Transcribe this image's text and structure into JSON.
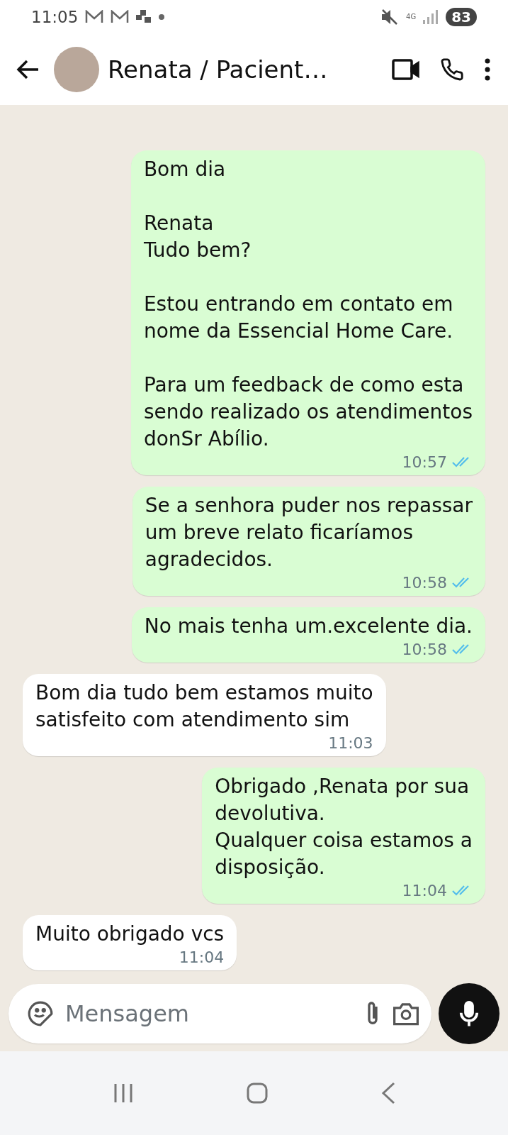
{
  "status_bar": {
    "time": "11:05",
    "network": "4G",
    "battery": "83"
  },
  "header": {
    "title": "Renata / Pacient…"
  },
  "messages": [
    {
      "kind": "sent",
      "text": "Bom dia\n\nRenata\nTudo bem?\n\nEstou entrando em contato em\nnome da Essencial Home Care.\n\nPara um feedback de como esta\nsendo realizado os atendimentos\ndonSr Abílio.",
      "time": "10:57",
      "read": true
    },
    {
      "kind": "sent",
      "text": "Se a senhora puder nos repassar\num breve relato ficaríamos\nagradecidos.",
      "time": "10:58",
      "read": true
    },
    {
      "kind": "sent",
      "text": "No mais tenha um.excelente dia.",
      "time": "10:58",
      "read": true
    },
    {
      "kind": "received",
      "text": "Bom dia tudo bem estamos muito\nsatisfeito com atendimento sim",
      "time": "11:03"
    },
    {
      "kind": "sent",
      "text": "Obrigado ,Renata por sua\ndevolutiva.\nQualquer coisa estamos a\ndisposição.",
      "time": "11:04",
      "read": true
    },
    {
      "kind": "received",
      "text": "Muito obrigado vcs",
      "time": "11:04"
    }
  ],
  "composer": {
    "placeholder": "Mensagem"
  }
}
